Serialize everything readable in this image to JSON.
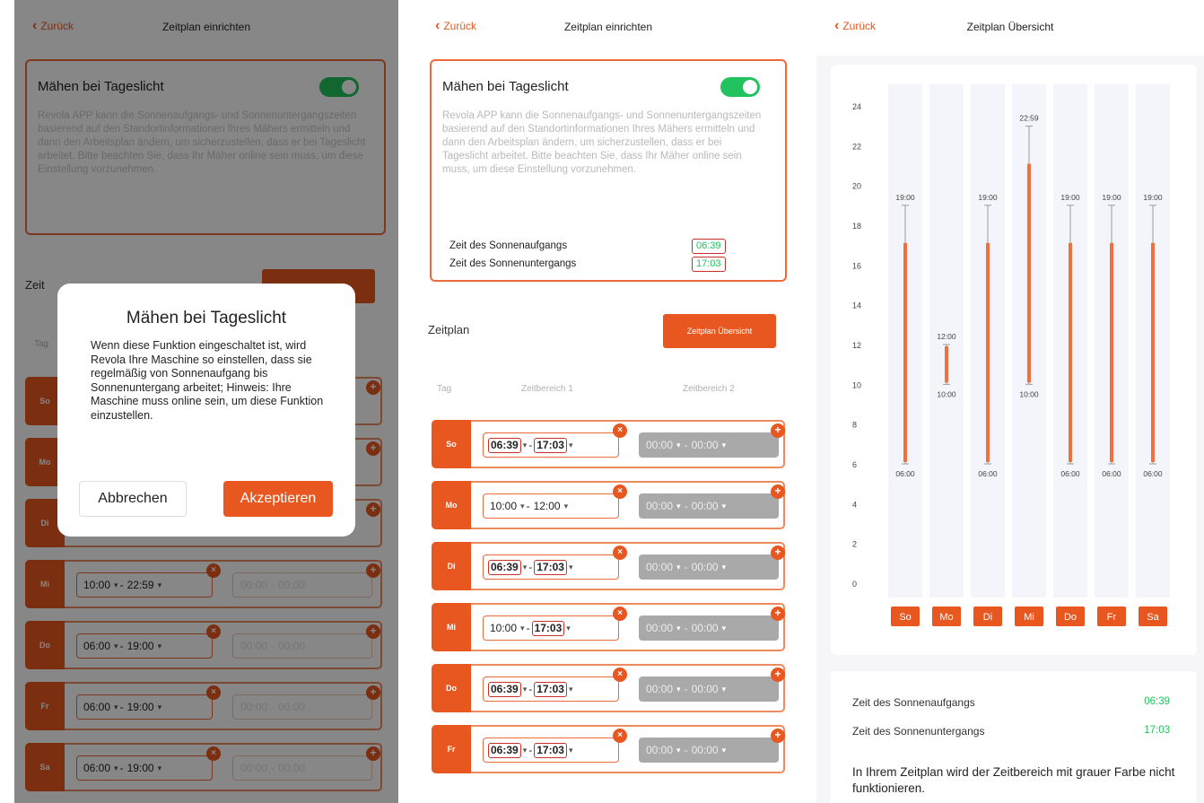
{
  "screens": {
    "setup": {
      "back_label": "Zurück",
      "title": "Zeitplan einrichten",
      "daylight_card": {
        "title": "Mähen bei Tageslicht",
        "toggle_on": true,
        "description": "Revola APP kann die Sonnenaufgangs- und Sonnenuntergangszeiten basierend auf den Standortinformationen Ihres Mähers ermitteln und dann den Arbeitsplan ändern, um sicherzustellen, dass er bei Tageslicht arbeitet. Bitte beachten Sie, dass Ihr Mäher online sein muss, um diese Einstellung vorzunehmen.",
        "sunrise_label": "Zeit des Sonnenaufgangs",
        "sunset_label": "Zeit des Sonnenuntergangs",
        "sunrise_value": "06:39",
        "sunset_value": "17:03"
      },
      "schedule": {
        "label": "Zeitplan",
        "overview_button": "Zeitplan Übersicht",
        "col_day": "Tag",
        "col_range1": "Zeitbereich 1",
        "col_range2": "Zeitbereich 2"
      },
      "days": [
        {
          "day": "So",
          "start": "06:39",
          "end": "17:03",
          "start_boxed": true,
          "end_boxed": true,
          "r2_start": "00:00",
          "r2_end": "00:00"
        },
        {
          "day": "Mo",
          "start": "10:00",
          "end": "12:00",
          "start_boxed": false,
          "end_boxed": false,
          "r2_start": "00:00",
          "r2_end": "00:00"
        },
        {
          "day": "Di",
          "start": "06:39",
          "end": "17:03",
          "start_boxed": true,
          "end_boxed": true,
          "r2_start": "00:00",
          "r2_end": "00:00"
        },
        {
          "day": "Mi",
          "start": "10:00",
          "end": "17:03",
          "start_boxed": false,
          "end_boxed": true,
          "r2_start": "00:00",
          "r2_end": "00:00"
        },
        {
          "day": "Do",
          "start": "06:39",
          "end": "17:03",
          "start_boxed": true,
          "end_boxed": true,
          "r2_start": "00:00",
          "r2_end": "00:00"
        },
        {
          "day": "Fr",
          "start": "06:39",
          "end": "17:03",
          "start_boxed": true,
          "end_boxed": true,
          "r2_start": "00:00",
          "r2_end": "00:00"
        }
      ]
    },
    "dialog_screen": {
      "back_label": "Zurück",
      "title": "Zeitplan einrichten",
      "card_title": "Mähen bei Tageslicht",
      "card_description": "Revola APP kann die Sonnenaufgangs- und Sonnenuntergangszeiten basierend auf den Standortinformationen Ihres Mähers ermitteln und dann den Arbeitsplan ändern, um sicherzustellen, dass er bei Tageslicht arbeitet. Bitte beachten Sie, dass Ihr Mäher online sein muss, um diese Einstellung vorzunehmen.",
      "schedule_label": "Zeit",
      "col_day": "Tag",
      "days": [
        {
          "day": "So"
        },
        {
          "day": "Mo"
        },
        {
          "day": "Di"
        },
        {
          "day": "Mi",
          "start": "10:00",
          "end": "22:59",
          "r2_start": "00:00",
          "r2_end": "00:00"
        },
        {
          "day": "Do",
          "start": "06:00",
          "end": "19:00",
          "r2_start": "00:00",
          "r2_end": "00:00"
        },
        {
          "day": "Fr",
          "start": "06:00",
          "end": "19:00",
          "r2_start": "00:00",
          "r2_end": "00:00"
        },
        {
          "day": "Sa",
          "start": "06:00",
          "end": "19:00",
          "r2_start": "00:00",
          "r2_end": "00:00"
        }
      ],
      "dialog": {
        "title": "Mähen bei Tageslicht",
        "body": "Wenn diese Funktion eingeschaltet ist, wird Revola Ihre Maschine so einstellen, dass sie regelmäßig von Sonnenaufgang bis Sonnenuntergang arbeitet; Hinweis: Ihre Maschine muss online sein, um diese Funktion einzustellen.",
        "cancel": "Abbrechen",
        "accept": "Akzeptieren"
      }
    },
    "overview": {
      "back_label": "Zurück",
      "title": "Zeitplan Übersicht",
      "sunrise_label": "Zeit des Sonnenaufgangs",
      "sunset_label": "Zeit des Sonnenuntergangs",
      "sunrise_value": "06:39",
      "sunset_value": "17:03",
      "note": "In Ihrem Zeitplan wird der Zeitbereich mit grauer Farbe nicht funktionieren."
    }
  },
  "colors": {
    "accent": "#e8571f",
    "toggle_on": "#22c35e",
    "sun_time_value": "#22c35e",
    "disabled_range": "#a9a9a9",
    "highlight_box": "#c9302c"
  },
  "chart_data": {
    "type": "bar",
    "subtype": "floating-range",
    "categories": [
      "So",
      "Mo",
      "Di",
      "Mi",
      "Do",
      "Fr",
      "Sa"
    ],
    "y_ticks": [
      0,
      2,
      4,
      6,
      8,
      10,
      12,
      14,
      16,
      18,
      20,
      22,
      24
    ],
    "ylim": [
      0,
      24
    ],
    "scheduled_start": [
      6,
      10,
      6,
      10,
      6,
      6,
      6
    ],
    "scheduled_end": [
      19,
      12,
      19,
      22.98,
      19,
      19,
      19
    ],
    "start_labels": [
      "06:00",
      "10:00",
      "06:00",
      "10:00",
      "06:00",
      "06:00",
      "06:00"
    ],
    "end_labels": [
      "19:00",
      "12:00",
      "19:00",
      "22:59",
      "19:00",
      "19:00",
      "19:00"
    ],
    "bar_color": "#f0703f",
    "range_line_color": "#9a9a9a",
    "column_bg": "#f3f5fa"
  }
}
